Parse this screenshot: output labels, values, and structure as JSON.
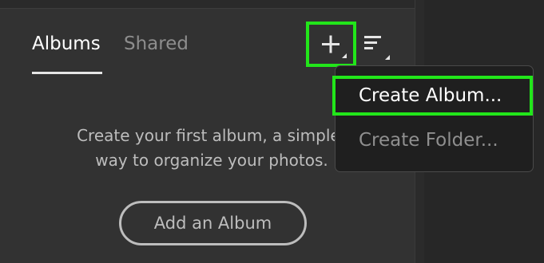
{
  "tabs": {
    "albums_label": "Albums",
    "shared_label": "Shared"
  },
  "toolbar": {
    "add_icon": "plus-icon",
    "sort_icon": "sort-lines-icon"
  },
  "dropdown_menu": {
    "items": [
      {
        "label": "Create Album...",
        "highlighted": true
      },
      {
        "label": "Create Folder...",
        "highlighted": false
      }
    ]
  },
  "empty_state": {
    "line1": "Create your first album, a simpler",
    "line2": "way to organize your photos.",
    "button_label": "Add an Album"
  },
  "colors": {
    "highlight_outline": "#22e61a",
    "panel_background": "#323232",
    "menu_background": "#1f1f1f",
    "active_tab": "#ffffff",
    "inactive_tab": "#8d8d8d"
  }
}
